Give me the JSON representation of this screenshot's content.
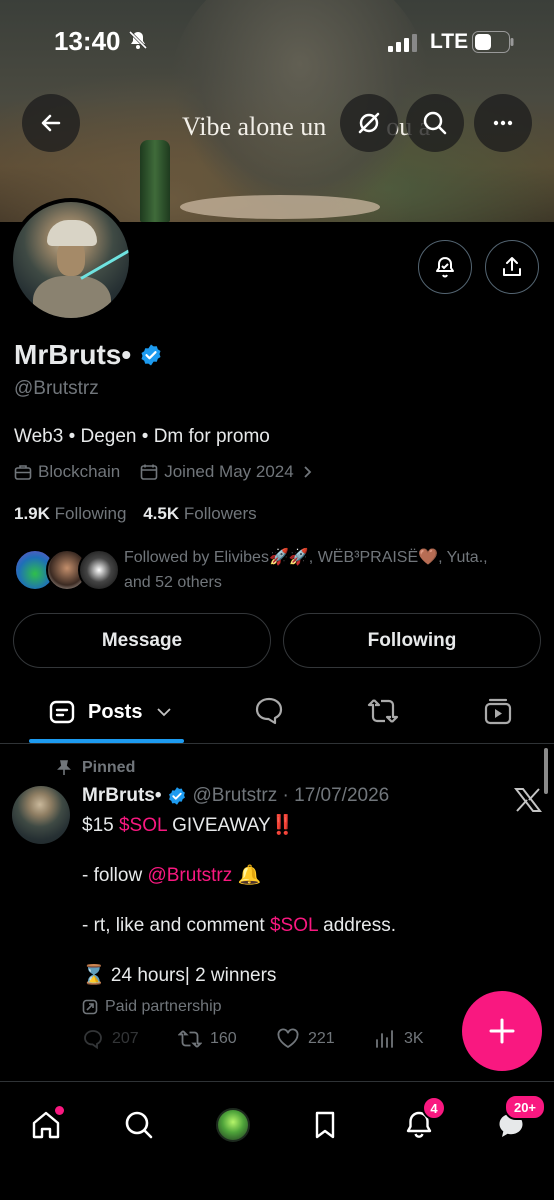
{
  "status_bar": {
    "time": "13:40",
    "network": "LTE"
  },
  "banner": {
    "text": "Vibe alone un",
    "tail": "ou  a"
  },
  "profile": {
    "name": "MrBruts•",
    "handle": "@Brutstrz",
    "bio": "Web3 • Degen • Dm for promo",
    "category": "Blockchain",
    "joined": "Joined May 2024",
    "following_count": "1.9K",
    "following_label": "Following",
    "followers_count": "4.5K",
    "followers_label": "Followers",
    "followed_by_line1": "Followed by Elivibes🚀🚀, WËB³PRAISË🤎, Yuta.,",
    "followed_by_line2": "and 52 others"
  },
  "buttons": {
    "message": "Message",
    "following": "Following"
  },
  "tabs": {
    "posts": "Posts"
  },
  "post": {
    "pinned_label": "Pinned",
    "author": "MrBruts•",
    "handle_date": "@Brutstrz · 17/07/2026",
    "line1_prefix": "$15 ",
    "line1_cashtag": "$SOL",
    "line1_suffix": " GIVEAWAY",
    "line1_emoji": "‼️",
    "line2_prefix": "- follow ",
    "line2_mention": "@Brutstrz",
    "line2_emoji": " 🔔",
    "line3_prefix": "- rt, like and comment ",
    "line3_cashtag": "$SOL",
    "line3_suffix": " address.",
    "line4": "⌛ 24 hours| 2 winners",
    "paid_label": "Paid partnership",
    "replies": "207",
    "reposts": "160",
    "likes": "221",
    "views": "3K"
  },
  "nav": {
    "notifications_badge": "4",
    "messages_badge": "20+"
  },
  "colors": {
    "accent": "#1d9bf0",
    "pink": "#f91880",
    "muted": "#71767b",
    "verified": "#1d9bf0"
  },
  "icons": [
    "back-arrow-icon",
    "hide-icon",
    "search-icon",
    "more-icon",
    "bell-add-icon",
    "share-icon",
    "verified-icon",
    "briefcase-icon",
    "calendar-icon",
    "chevron-right-icon",
    "posts-icon",
    "chevron-down-icon",
    "replies-icon",
    "repost-icon",
    "media-icon",
    "pin-icon",
    "x-logo-icon",
    "paid-icon",
    "reply-icon",
    "like-icon",
    "views-icon",
    "plus-icon",
    "home-icon",
    "grok-icon",
    "bookmark-icon",
    "bell-icon",
    "messages-icon"
  ]
}
